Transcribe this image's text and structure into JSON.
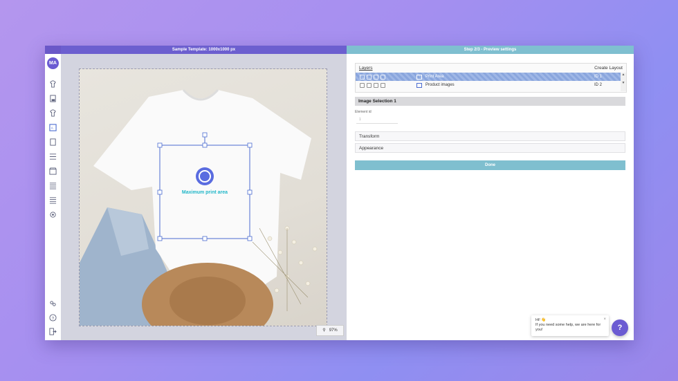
{
  "left_panel": {
    "title": "Sample Template: 1000x1000 px",
    "print_area_label": "Maximum print area",
    "zoom": "97%"
  },
  "sidebar": {
    "avatar": "MA",
    "icons": [
      "shirt-icon",
      "document-icon",
      "apparel-icon",
      "image-editor-icon",
      "page-icon",
      "list-settings-icon",
      "store-icon",
      "list-icon",
      "list-alt-icon",
      "settings-icon"
    ],
    "bottom_icons": [
      "users-icon",
      "help-circle-icon",
      "exit-icon"
    ]
  },
  "right_panel": {
    "title": "Step 2/3 - Preview settings",
    "layers": {
      "title": "Layers",
      "create_layout": "Create Layout",
      "rows": [
        {
          "name": "Print Area",
          "id": "ID 1",
          "selected": true
        },
        {
          "name": "Product images",
          "id": "ID 2",
          "selected": false
        }
      ]
    },
    "section_title": "Image Selection 1",
    "element_id_label": "Element id",
    "element_id_value": "1",
    "transform": "Transform",
    "appearance": "Appearance",
    "done": "Done"
  },
  "chat": {
    "line1": "Hi! 👋",
    "line2": "If you need some help, we are here for you!",
    "close": "×",
    "help": "?"
  },
  "colors": {
    "accent": "#6b5bd2",
    "done": "#7fbfcf",
    "selection": "#4a6bd0",
    "print_text": "#1fb6c8"
  }
}
